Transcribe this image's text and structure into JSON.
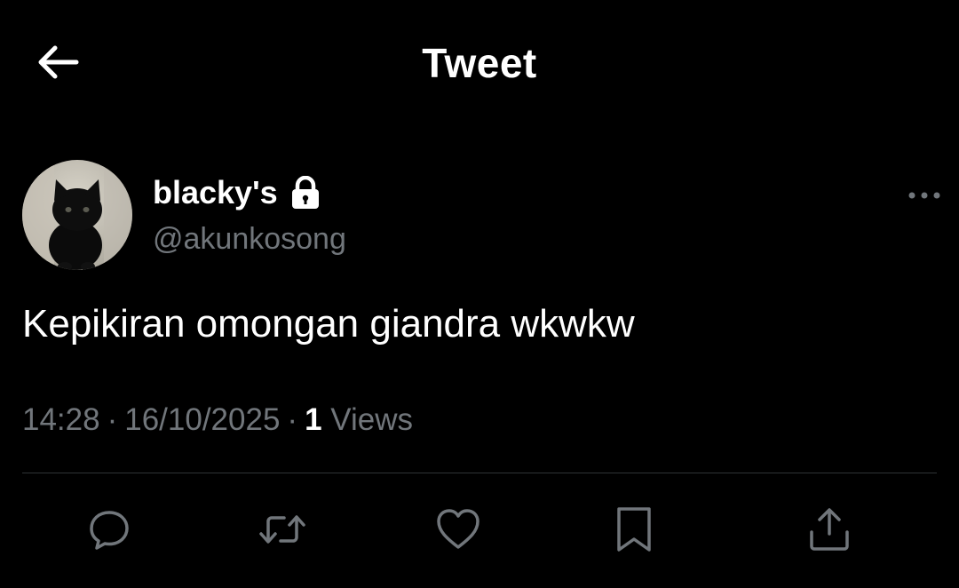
{
  "header": {
    "title": "Tweet",
    "back_icon": "arrow-left-icon"
  },
  "author": {
    "display_name": "blacky's",
    "handle": "@akunkosong",
    "protected_icon": "lock-icon",
    "avatar": "black-kitten-avatar"
  },
  "tweet": {
    "text": "Kepikiran omongan giandra wkwkw",
    "time": "14:28",
    "date": "16/10/2025",
    "views_count": "1",
    "views_label": "Views"
  },
  "actions": [
    {
      "name": "reply",
      "icon": "reply-icon"
    },
    {
      "name": "retweet",
      "icon": "retweet-icon"
    },
    {
      "name": "like",
      "icon": "heart-icon"
    },
    {
      "name": "bookmark",
      "icon": "bookmark-icon"
    },
    {
      "name": "share",
      "icon": "share-icon"
    }
  ],
  "colors": {
    "background": "#000000",
    "primary_text": "#ffffff",
    "secondary_text": "#71767b",
    "divider": "#2f3336"
  }
}
